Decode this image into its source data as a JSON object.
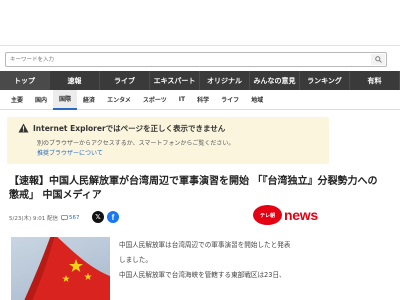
{
  "search": {
    "placeholder": "キーワードを入力"
  },
  "global_nav": {
    "items": [
      {
        "label": "トップ",
        "active": true
      },
      {
        "label": "速報"
      },
      {
        "label": "ライブ"
      },
      {
        "label": "エキスパート"
      },
      {
        "label": "オリジナル"
      },
      {
        "label": "みんなの意見"
      },
      {
        "label": "ランキング"
      },
      {
        "label": "有料"
      }
    ]
  },
  "sub_nav": {
    "items": [
      {
        "label": "主要"
      },
      {
        "label": "国内"
      },
      {
        "label": "国際",
        "active": true
      },
      {
        "label": "経済"
      },
      {
        "label": "エンタメ"
      },
      {
        "label": "スポーツ"
      },
      {
        "label": "IT"
      },
      {
        "label": "科学"
      },
      {
        "label": "ライフ"
      },
      {
        "label": "地域"
      }
    ]
  },
  "notice": {
    "title": "Internet Explorerではページを正しく表示できません",
    "body": "別のブラウザーからアクセスするか、スマートフォンからご覧ください。",
    "link": "推奨ブラウザーについて"
  },
  "article": {
    "headline": "【速報】中国人民解放軍が台湾周辺で軍事演習を開始 「『台湾独立』分裂勢力への懲戒」 中国メディア",
    "date": "5/23(木) 9:01 配信",
    "comment_count": "567",
    "source_badge": "テレ朝",
    "source_name": "news",
    "body_lines": [
      "中国人民解放軍は台湾周辺での軍事演習を開始したと発表",
      "しました。",
      "中国人民解放軍で台湾海峡を管轄する東部戦区は23日、"
    ]
  },
  "colors": {
    "nav_bg": "#3a3a3a",
    "notice_bg": "#fbf5de",
    "brand_red": "#e50012",
    "link_blue": "#2a6bbf"
  }
}
